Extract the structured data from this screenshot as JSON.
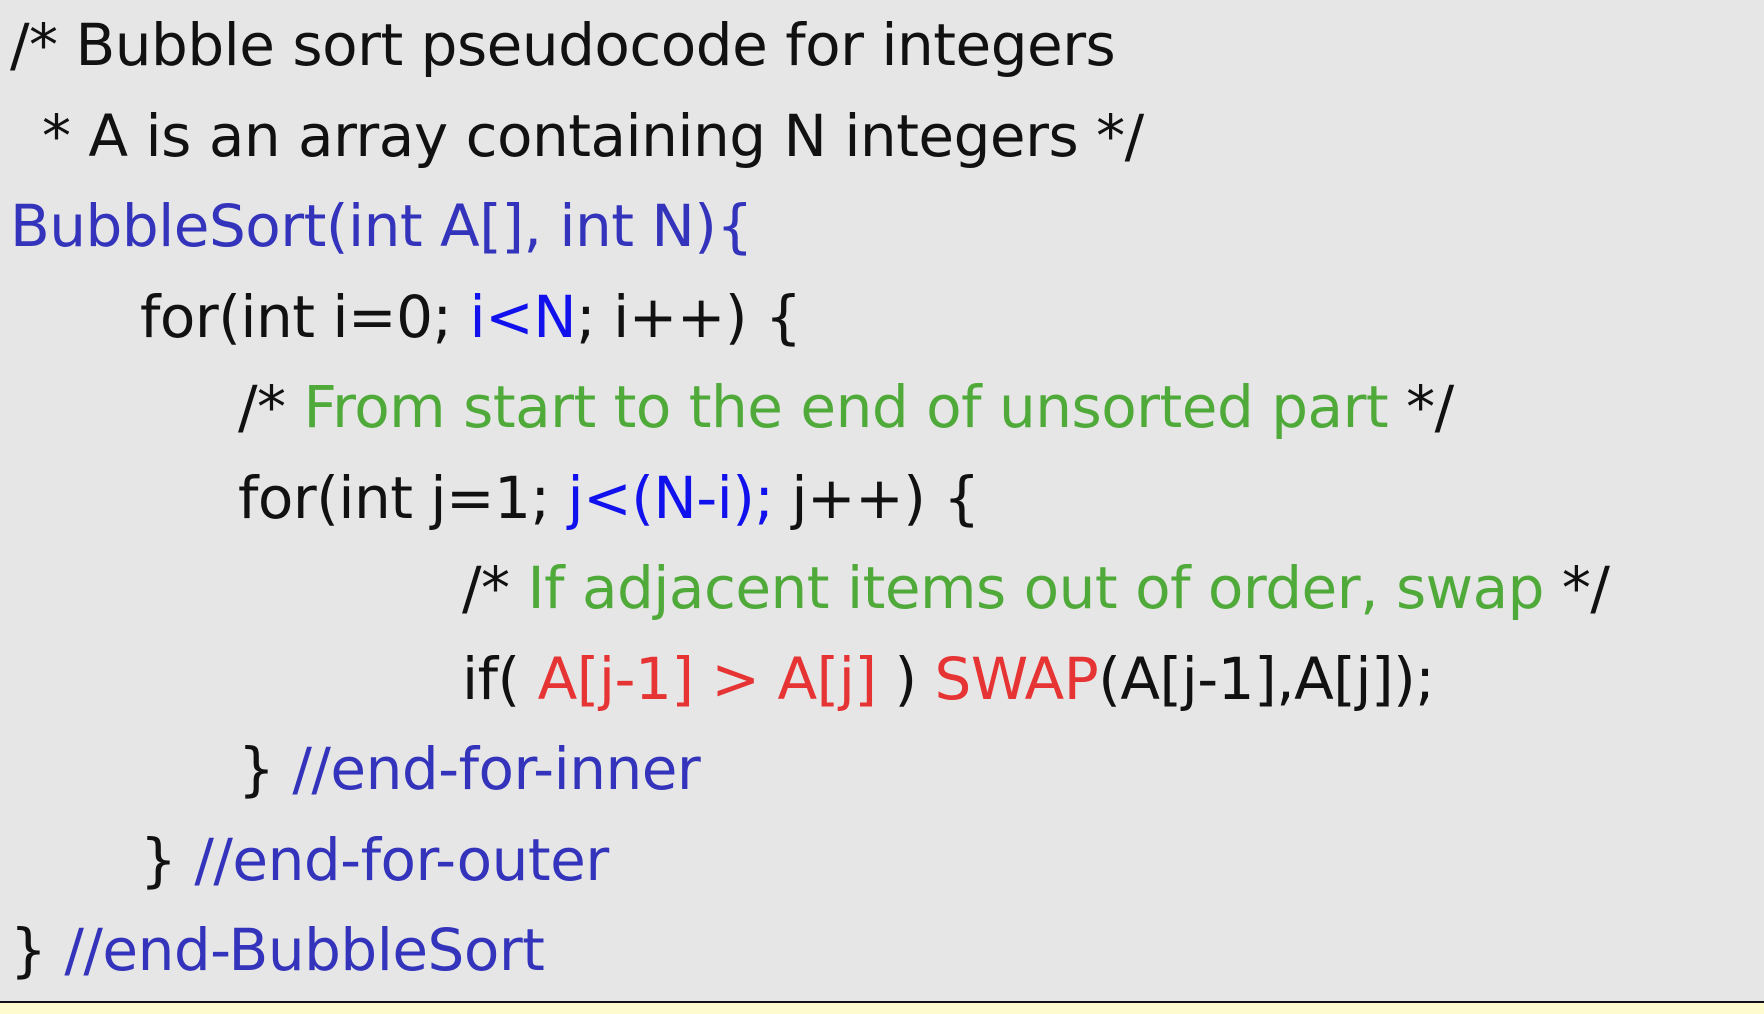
{
  "colors": {
    "background": "#e6e6e6",
    "strip": "#fefccf",
    "text": "#111111",
    "function_blue": "#3333bb",
    "condition_blue": "#1111ee",
    "comment_green": "#4faa3a",
    "highlight_red": "#e63333"
  },
  "code": {
    "lines": [
      {
        "indent": 0,
        "tokens": [
          {
            "text": "/* Bubble sort pseudocode for integers",
            "style": "black"
          }
        ]
      },
      {
        "indent": 1,
        "tokens": [
          {
            "text": "* A is an array containing N integers */",
            "style": "black"
          }
        ]
      },
      {
        "indent": 0,
        "tokens": [
          {
            "text": "BubbleSort(int A[], int N){",
            "style": "fn"
          }
        ]
      },
      {
        "indent": 2,
        "tokens": [
          {
            "text": "for(int i=0; ",
            "style": "black"
          },
          {
            "text": "i<N",
            "style": "cond"
          },
          {
            "text": "; i++) {",
            "style": "black"
          }
        ]
      },
      {
        "indent": 3,
        "tokens": [
          {
            "text": "/* ",
            "style": "black"
          },
          {
            "text": "From start to the end of unsorted part",
            "style": "comment"
          },
          {
            "text": " */",
            "style": "black"
          }
        ]
      },
      {
        "indent": 3,
        "tokens": [
          {
            "text": "for(int j=1; ",
            "style": "black"
          },
          {
            "text": "j<(N-i);",
            "style": "cond"
          },
          {
            "text": " j++) {",
            "style": "black"
          }
        ]
      },
      {
        "indent": 4,
        "tokens": [
          {
            "text": "/* ",
            "style": "black"
          },
          {
            "text": "If adjacent items out of order, swap",
            "style": "comment"
          },
          {
            "text": " */",
            "style": "black"
          }
        ]
      },
      {
        "indent": 4,
        "tokens": [
          {
            "text": "if( ",
            "style": "black"
          },
          {
            "text": "A[j-1] > A[j]",
            "style": "red"
          },
          {
            "text": " ) ",
            "style": "black"
          },
          {
            "text": "SWAP",
            "style": "red"
          },
          {
            "text": "(A[j-1],A[j]);",
            "style": "black"
          }
        ]
      },
      {
        "indent": 3,
        "tokens": [
          {
            "text": "} ",
            "style": "black"
          },
          {
            "text": "//end-for-inner",
            "style": "fn"
          }
        ]
      },
      {
        "indent": 2,
        "tokens": [
          {
            "text": "} ",
            "style": "black"
          },
          {
            "text": "//end-for-outer",
            "style": "fn"
          }
        ]
      },
      {
        "indent": 0,
        "tokens": [
          {
            "text": "} ",
            "style": "black"
          },
          {
            "text": "//end-BubbleSort",
            "style": "fn"
          }
        ]
      }
    ]
  }
}
